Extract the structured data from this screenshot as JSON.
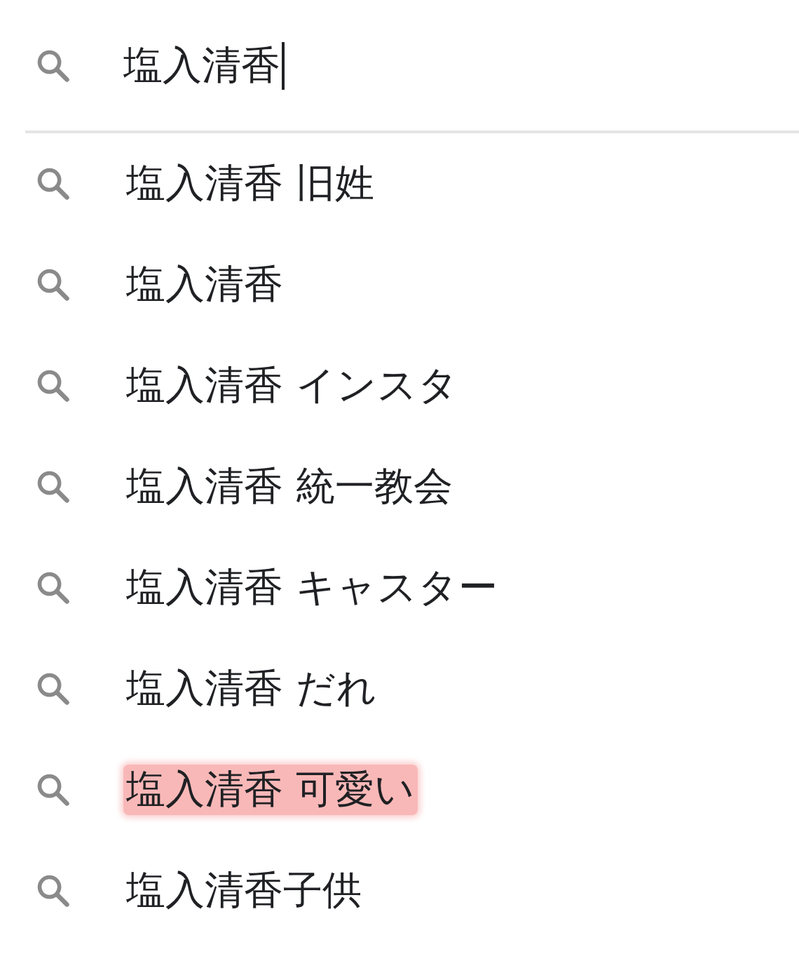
{
  "search": {
    "value": "塩入清香"
  },
  "suggestions": [
    {
      "text": "塩入清香 旧姓",
      "highlighted": false
    },
    {
      "text": "塩入清香",
      "highlighted": false
    },
    {
      "text": "塩入清香 インスタ",
      "highlighted": false
    },
    {
      "text": "塩入清香 統一教会",
      "highlighted": false
    },
    {
      "text": "塩入清香 キャスター",
      "highlighted": false
    },
    {
      "text": "塩入清香 だれ",
      "highlighted": false
    },
    {
      "text": "塩入清香 可愛い",
      "highlighted": true
    },
    {
      "text": "塩入清香子供",
      "highlighted": false
    }
  ]
}
